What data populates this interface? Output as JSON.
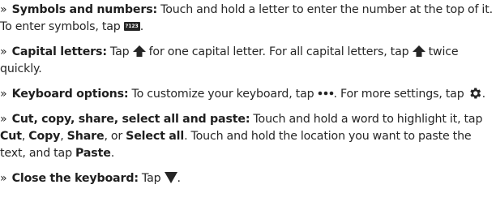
{
  "bullet": "»",
  "items": [
    {
      "label": "Symbols and numbers:",
      "text1": " Touch and hold a letter to enter the number at the top of it. To enter symbols, tap ",
      "key_label": "?123",
      "text2": "."
    },
    {
      "label": "Capital letters:",
      "text1": " Tap ",
      "text2": " for one capital letter. For all capital letters, tap ",
      "text3": " twice quickly.",
      "icon": "shift-arrow-icon"
    },
    {
      "label": "Keyboard options:",
      "text1": " To customize your keyboard, tap ",
      "text2": ". For more settings, tap ",
      "text3": ".",
      "icons": [
        "more-dots-icon",
        "settings-gear-icon"
      ]
    },
    {
      "label": "Cut, copy, share, select all and paste:",
      "text1": " Touch and hold a word to highlight it, tap ",
      "cut": "Cut",
      "sep1": ", ",
      "copy": "Copy",
      "sep2": ", ",
      "share": "Share",
      "sep3": ", or ",
      "select_all": "Select all",
      "text2": ". Touch and hold the location you want to paste the text, and tap ",
      "paste": "Paste",
      "text3": "."
    },
    {
      "label": "Close the keyboard:",
      "text1": " Tap ",
      "text2": ".",
      "icon": "hide-keyboard-triangle-icon"
    }
  ],
  "colors": {
    "text": "#262626",
    "icon": "#262626"
  }
}
